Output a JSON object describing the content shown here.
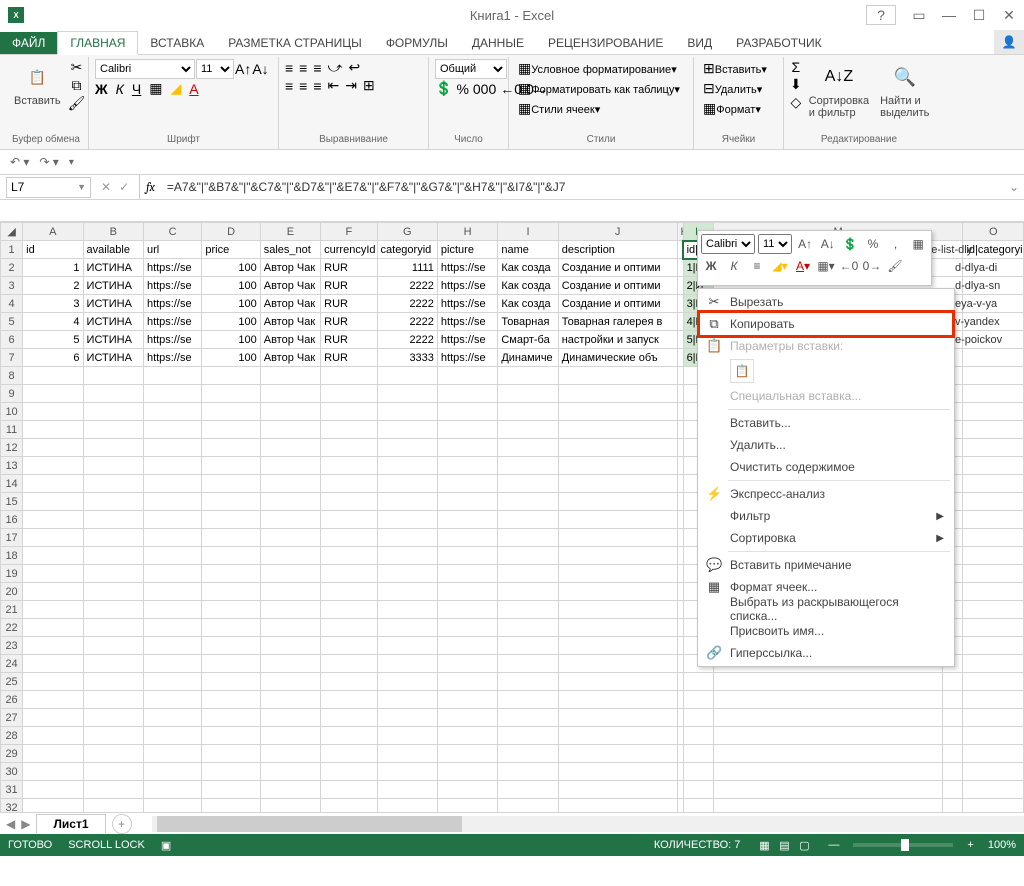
{
  "titlebar": {
    "title": "Книга1 - Excel"
  },
  "tabs": {
    "file": "ФАЙЛ",
    "items": [
      "ГЛАВНАЯ",
      "ВСТАВКА",
      "РАЗМЕТКА СТРАНИЦЫ",
      "ФОРМУЛЫ",
      "ДАННЫЕ",
      "РЕЦЕНЗИРОВАНИЕ",
      "ВИД",
      "РАЗРАБОТЧИК"
    ],
    "active": "ГЛАВНАЯ"
  },
  "ribbon": {
    "clipboard": {
      "paste": "Вставить",
      "label": "Буфер обмена"
    },
    "font": {
      "name": "Calibri",
      "size": "11",
      "label": "Шрифт"
    },
    "align": {
      "label": "Выравнивание"
    },
    "number": {
      "format": "Общий",
      "label": "Число"
    },
    "styles": {
      "cond": "Условное форматирование",
      "table": "Форматировать как таблицу",
      "cell": "Стили ячеек",
      "label": "Стили"
    },
    "cells": {
      "insert": "Вставить",
      "delete": "Удалить",
      "format": "Формат",
      "label": "Ячейки"
    },
    "editing": {
      "sort": "Сортировка и фильтр",
      "find": "Найти и выделить",
      "label": "Редактирование"
    }
  },
  "formula": {
    "cell": "L7",
    "fx": "fx",
    "value": "=A7&\"|\"&B7&\"|\"&C7&\"|\"&D7&\"|\"&E7&\"|\"&F7&\"|\"&G7&\"|\"&H7&\"|\"&I7&\"|\"&J7"
  },
  "columns": [
    "A",
    "B",
    "C",
    "D",
    "E",
    "F",
    "G",
    "H",
    "I",
    "J",
    "K",
    "L",
    "M",
    "N",
    "O"
  ],
  "headers": {
    "A": "id",
    "B": "available",
    "C": "url",
    "D": "price",
    "E": "sales_not",
    "F": "currencyId",
    "G": "categoryid",
    "H": "picture",
    "I": "name",
    "J": "description",
    "K": "",
    "L": "id|available",
    "O": "id|categoryi"
  },
  "rows": [
    {
      "A": "1",
      "B": "ИСТИНА",
      "C": "https://se",
      "D": "100",
      "E": "Автор Чак",
      "F": "RUR",
      "G": "1111",
      "H": "https://se",
      "I": "Как созда",
      "J": "Создание и оптими",
      "L": "1|И",
      "M": "ИСТИНА|https://seopulses.ru/kak-sozdat-price-list-dly"
    },
    {
      "A": "2",
      "B": "ИСТИНА",
      "C": "https://se",
      "D": "100",
      "E": "Автор Чак",
      "F": "RUR",
      "G": "2222",
      "H": "https://se",
      "I": "Как созда",
      "J": "Создание и оптими",
      "L": "2|И",
      "M": "d-dlya-di"
    },
    {
      "A": "3",
      "B": "ИСТИНА",
      "C": "https://se",
      "D": "100",
      "E": "Автор Чак",
      "F": "RUR",
      "G": "2222",
      "H": "https://se",
      "I": "Как созда",
      "J": "Создание и оптими",
      "L": "3|И",
      "M": "d-dlya-sn"
    },
    {
      "A": "4",
      "B": "ИСТИНА",
      "C": "https://se",
      "D": "100",
      "E": "Автор Чак",
      "F": "RUR",
      "G": "2222",
      "H": "https://se",
      "I": "Товарная",
      "J": "Товарная галерея в",
      "L": "4|И",
      "M": "eya-v-ya"
    },
    {
      "A": "5",
      "B": "ИСТИНА",
      "C": "https://se",
      "D": "100",
      "E": "Автор Чак",
      "F": "RUR",
      "G": "2222",
      "H": "https://se",
      "I": "Смарт-ба",
      "J": "настройки и запуск",
      "L": "5|И",
      "M": "v-yandex"
    },
    {
      "A": "6",
      "B": "ИСТИНА",
      "C": "https://se",
      "D": "100",
      "E": "Автор Чак",
      "F": "RUR",
      "G": "3333",
      "H": "https://se",
      "I": "Динамиче",
      "J": "Динамические объ",
      "L": "6|И",
      "M": "e-poickov"
    }
  ],
  "mini": {
    "font": "Calibri",
    "size": "11"
  },
  "context": {
    "cut": "Вырезать",
    "copy": "Копировать",
    "paste_params": "Параметры вставки:",
    "paste_special": "Специальная вставка...",
    "insert": "Вставить...",
    "delete": "Удалить...",
    "clear": "Очистить содержимое",
    "quick": "Экспресс-анализ",
    "filter": "Фильтр",
    "sort": "Сортировка",
    "comment": "Вставить примечание",
    "format_cells": "Формат ячеек...",
    "dropdown": "Выбрать из раскрывающегося списка...",
    "name": "Присвоить имя...",
    "hyperlink": "Гиперссылка..."
  },
  "sheet": {
    "name": "Лист1"
  },
  "status": {
    "ready": "ГОТОВО",
    "scroll": "SCROLL LOCK",
    "count_label": "КОЛИЧЕСТВО:",
    "count": "7",
    "zoom": "100%"
  }
}
